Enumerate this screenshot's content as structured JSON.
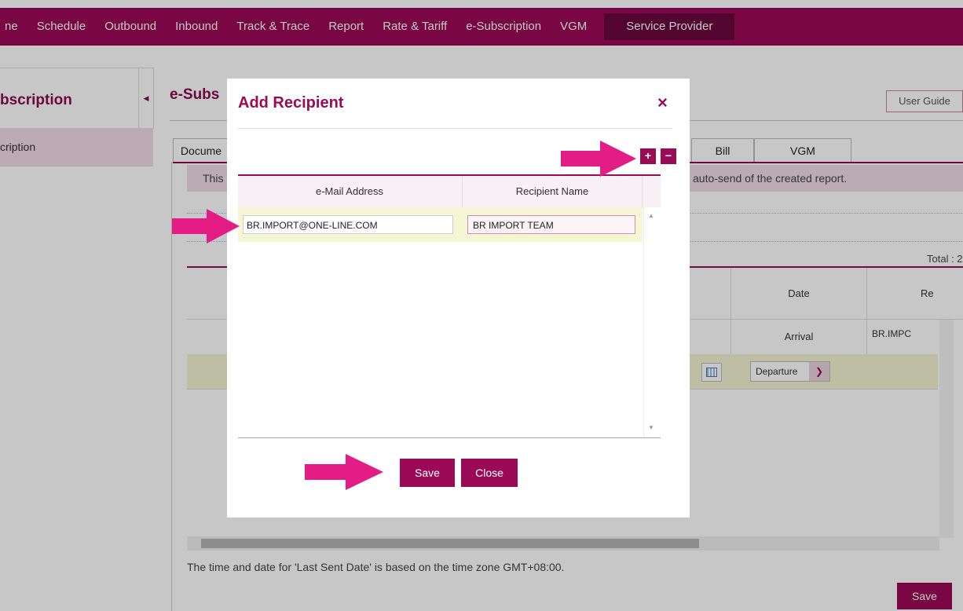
{
  "nav": {
    "items": [
      "ne",
      "Schedule",
      "Outbound",
      "Inbound",
      "Track & Trace",
      "Report",
      "Rate & Tariff",
      "e-Subscription",
      "VGM"
    ],
    "active": "Service Provider"
  },
  "sidebar": {
    "title": "bscription",
    "item": "cription"
  },
  "main": {
    "title": "e-Subs",
    "user_guide": "User Guide",
    "tabs": [
      "Docume",
      "Bill",
      "VGM"
    ],
    "notice_left": "This",
    "notice_right": "auto-send of the created report.",
    "total": "Total : 2",
    "col_date": "Date",
    "col_re": "Re",
    "row1_date": "Arrival",
    "row1_email": "BR.IMPC",
    "row2_date": "Departure",
    "footnote": "The time and date for 'Last Sent Date' is based on the time zone GMT+08:00.",
    "save": "Save"
  },
  "modal": {
    "title": "Add Recipient",
    "close_icon": "×",
    "add_label": "+",
    "remove_label": "−",
    "col_email": "e-Mail Address",
    "col_name": "Recipient Name",
    "email_value": "BR.IMPORT@ONE-LINE.COM",
    "name_value": "BR IMPORT TEAM",
    "save": "Save",
    "close": "Close"
  },
  "colors": {
    "brand": "#9b0a57",
    "arrow": "#e31c86"
  }
}
